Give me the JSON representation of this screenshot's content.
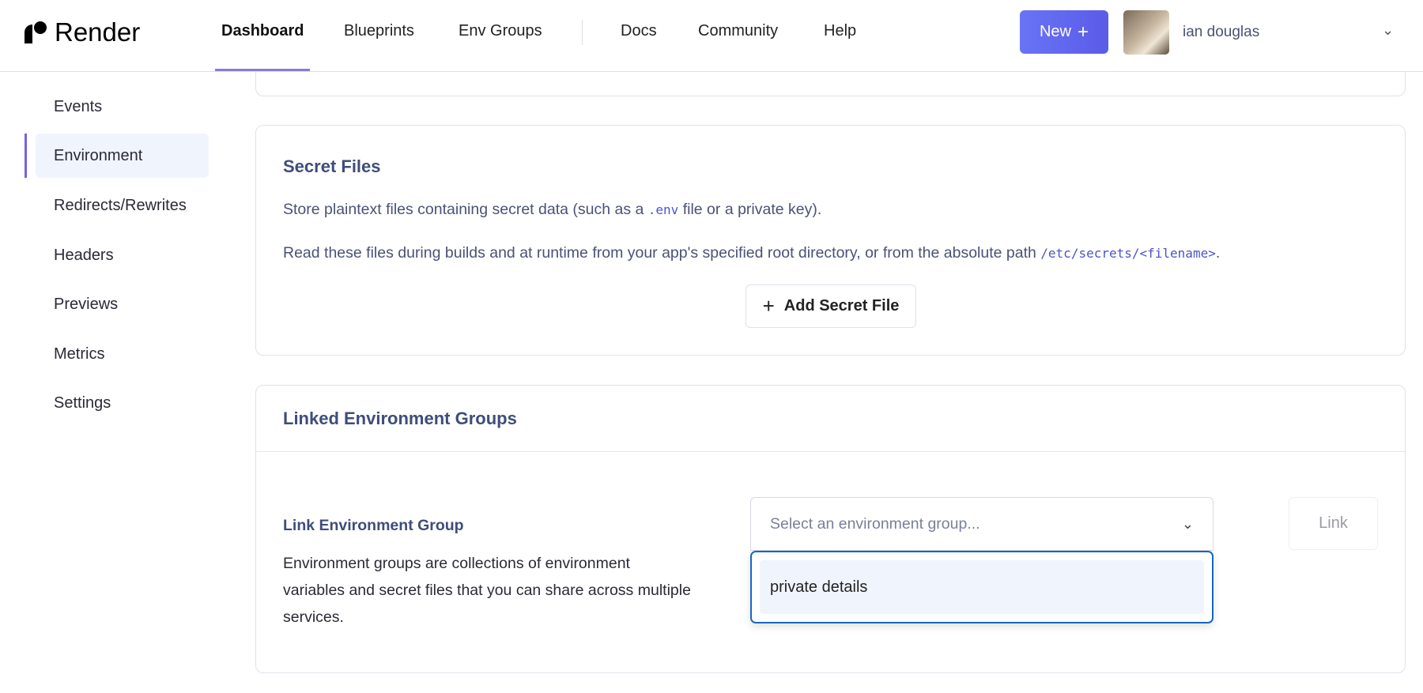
{
  "header": {
    "brand": "Render",
    "nav": [
      {
        "label": "Dashboard",
        "active": true
      },
      {
        "label": "Blueprints"
      },
      {
        "label": "Env Groups"
      },
      {
        "label": "Docs"
      },
      {
        "label": "Community"
      },
      {
        "label": "Help"
      }
    ],
    "new_button": "New",
    "user_name": "ian douglas"
  },
  "sidebar": {
    "items": [
      {
        "label": "Events"
      },
      {
        "label": "Environment",
        "active": true
      },
      {
        "label": "Redirects/Rewrites"
      },
      {
        "label": "Headers"
      },
      {
        "label": "Previews"
      },
      {
        "label": "Metrics"
      },
      {
        "label": "Settings"
      }
    ]
  },
  "secret_files": {
    "title": "Secret Files",
    "line1_pre": "Store plaintext files containing secret data (such as a ",
    "line1_code": ".env",
    "line1_post": " file or a private key).",
    "line2_pre": "Read these files during builds and at runtime from your app's specified root directory, or from the absolute path ",
    "line2_code": "/etc/secrets/<filename>",
    "line2_post": ".",
    "add_button": "Add Secret File"
  },
  "linked_groups": {
    "title": "Linked Environment Groups",
    "label": "Link Environment Group",
    "desc_lines": [
      "Environment groups are collections of environment",
      "variables and secret files that you can share across multiple",
      "services."
    ],
    "select_placeholder": "Select an environment group...",
    "options": [
      "private details"
    ],
    "link_button": "Link"
  },
  "colors": {
    "accent": "#5b5be8",
    "focus": "#1766c4",
    "active_bar": "#7b61e0"
  }
}
